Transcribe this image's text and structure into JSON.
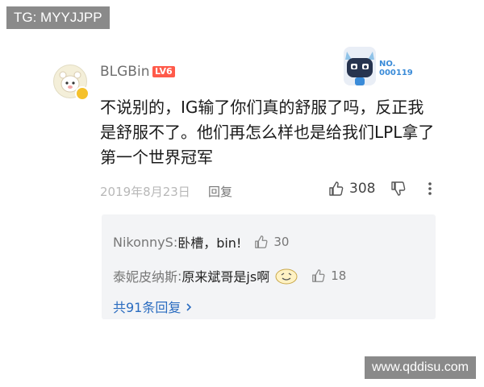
{
  "watermarks": {
    "top": "TG: MYYJJPP",
    "bottom": "www.qddisu.com"
  },
  "comment": {
    "username": "BLGBin",
    "level": "LV6",
    "card_number_label": "NO.",
    "card_number": "000119",
    "text": "不说别的，IG输了你们真的舒服了吗，反正我是舒服不了。他们再怎么样也是给我们LPL拿了第一个世界冠军",
    "date": "2019年8月23日",
    "reply_label": "回复",
    "like_count": "308"
  },
  "replies": [
    {
      "author": "NikonnyS",
      "separator": ": ",
      "text": "卧槽，bin!",
      "likes": "30"
    },
    {
      "author": "泰妮皮纳斯",
      "separator": ": ",
      "text": "原来斌哥是js啊",
      "likes": "18"
    }
  ],
  "more_replies_label": "共91条回复",
  "colors": {
    "level_badge": "#ff5a4a",
    "link": "#2a6cc0",
    "reply_bg": "#f3f4f6"
  }
}
